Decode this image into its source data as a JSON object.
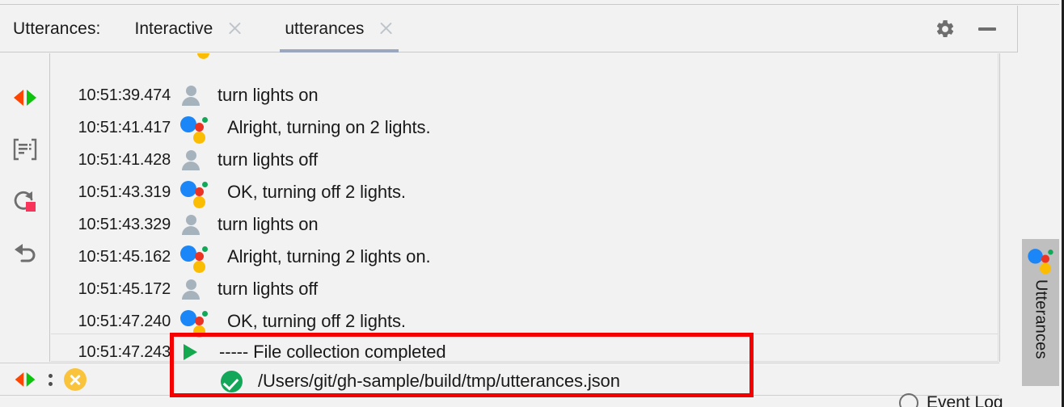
{
  "window": {
    "toolbar_label": "Utterances:",
    "tabs": [
      {
        "label": "Interactive",
        "active": false,
        "close_icon": "close-icon"
      },
      {
        "label": "utterances",
        "active": true,
        "close_icon": "close-icon"
      }
    ],
    "actions": [
      {
        "name": "settings-button",
        "icon": "gear-icon"
      },
      {
        "name": "minimize-button",
        "icon": "minimize-icon"
      }
    ]
  },
  "left_toolbar": {
    "items": [
      {
        "name": "rerun-button",
        "icon": "orange-green-arrows-icon"
      },
      {
        "name": "toggle-console-button",
        "icon": "console-brackets-icon"
      },
      {
        "name": "restart-stop-button",
        "icon": "refresh-stop-icon"
      },
      {
        "name": "undo-button",
        "icon": "undo-arrow-icon"
      }
    ]
  },
  "log": {
    "rows": [
      {
        "time": "10:51:39.474",
        "icon": "user-icon",
        "text": "turn lights on"
      },
      {
        "time": "10:51:41.417",
        "icon": "assistant-icon",
        "text": "Alright, turning on 2 lights."
      },
      {
        "time": "10:51:41.428",
        "icon": "user-icon",
        "text": "turn lights off"
      },
      {
        "time": "10:51:43.319",
        "icon": "assistant-icon",
        "text": "OK, turning off 2 lights."
      },
      {
        "time": "10:51:43.329",
        "icon": "user-icon",
        "text": "turn lights on"
      },
      {
        "time": "10:51:45.162",
        "icon": "assistant-icon",
        "text": "Alright, turning 2 lights on."
      },
      {
        "time": "10:51:45.172",
        "icon": "user-icon",
        "text": "turn lights off"
      },
      {
        "time": "10:51:47.240",
        "icon": "assistant-icon",
        "text": "OK, turning off 2 lights."
      },
      {
        "time": "10:51:47.243",
        "icon": "play-icon",
        "text": "----- File collection completed"
      },
      {
        "time": "",
        "icon": "success-check-icon",
        "text": "/Users/git/gh-sample/build/tmp/utterances.json"
      }
    ]
  },
  "status_bar": {
    "items": [
      {
        "name": "status-arrows",
        "icon": "orange-green-arrows-icon"
      },
      {
        "name": "more-options",
        "icon": "vertical-dots-icon"
      },
      {
        "name": "error-indicator",
        "icon": "orange-x-circle-icon"
      }
    ]
  },
  "side_tab": {
    "label": "Utterances",
    "icon": "assistant-icon"
  },
  "footer": {
    "event_log_label": "Event Log",
    "event_log_icon": "circle-icon"
  },
  "annotation": {
    "name": "red-highlight-box",
    "color": "#f40000"
  },
  "colors": {
    "background": "#f2f2f2",
    "tab_underline": "#9aa7bf",
    "assistant_blue": "#1a86f7",
    "assistant_red": "#ea3323",
    "assistant_green": "#0fa958",
    "assistant_yellow": "#fbbc04",
    "success_green": "#14a75a",
    "play_green": "#15a94f",
    "warning_orange": "#fbc02d",
    "annotation_red": "#f40000"
  }
}
